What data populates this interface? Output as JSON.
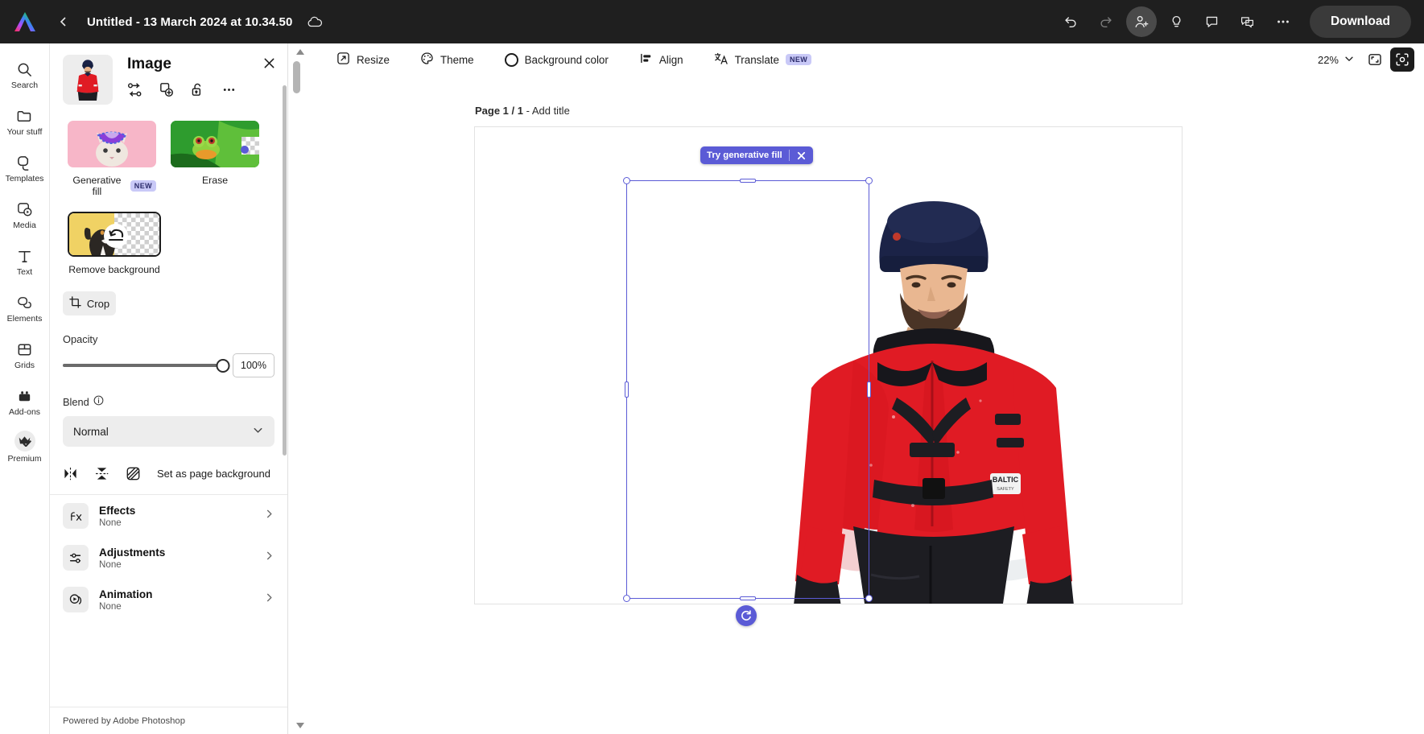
{
  "topbar": {
    "logo_icon": "adobe-express-logo",
    "back_icon": "chevron-left-icon",
    "title": "Untitled - 13 March 2024 at 10.34.50",
    "cloud_icon": "cloud-saved-icon",
    "undo_icon": "undo-icon",
    "redo_icon": "redo-icon",
    "invite_icon": "invite-collaborator-icon",
    "ideas_icon": "lightbulb-icon",
    "comment_icon": "comment-icon",
    "duplicate_comment_icon": "comments-stack-icon",
    "more_icon": "more-options-icon",
    "download_label": "Download"
  },
  "rail": {
    "items": [
      {
        "label": "Search",
        "icon": "search-icon"
      },
      {
        "label": "Your stuff",
        "icon": "folder-icon"
      },
      {
        "label": "Templates",
        "icon": "templates-icon"
      },
      {
        "label": "Media",
        "icon": "media-icon"
      },
      {
        "label": "Text",
        "icon": "text-icon"
      },
      {
        "label": "Elements",
        "icon": "elements-icon"
      },
      {
        "label": "Grids",
        "icon": "grids-icon"
      },
      {
        "label": "Add-ons",
        "icon": "addons-icon"
      },
      {
        "label": "Premium",
        "icon": "premium-crown-icon"
      }
    ]
  },
  "panel": {
    "title": "Image",
    "thumbnail_alt": "selected-image-thumbnail",
    "tools": [
      {
        "name": "replace-image-icon"
      },
      {
        "name": "duplicate-icon"
      },
      {
        "name": "unlock-icon"
      },
      {
        "name": "more-options-icon"
      }
    ],
    "close_icon": "close-icon",
    "ai_cards": [
      {
        "label": "Generative fill",
        "badge": "NEW",
        "thumb": "cat-with-bowtie-selection"
      },
      {
        "label": "Erase",
        "badge": "",
        "thumb": "green-frog-on-leaf"
      }
    ],
    "remove_background": {
      "label": "Remove background",
      "thumb": "dog-on-yellow-with-transparency",
      "overlay_icon": "undo-restore-icon",
      "selected": true
    },
    "crop": {
      "label": "Crop",
      "icon": "crop-icon"
    },
    "opacity": {
      "label": "Opacity",
      "value": "100%",
      "percent": 100
    },
    "blend": {
      "label": "Blend",
      "info_icon": "info-icon",
      "value": "Normal",
      "chevron": "chevron-down-icon"
    },
    "transform_row": {
      "flip_horizontal_icon": "flip-horizontal-icon",
      "flip_vertical_icon": "flip-vertical-icon",
      "page_background_icon": "set-as-page-background-icon",
      "page_background_label": "Set as page background"
    },
    "sections": [
      {
        "title": "Effects",
        "subtitle": "None",
        "icon": "fx-icon",
        "chevron": "chevron-right-icon"
      },
      {
        "title": "Adjustments",
        "subtitle": "None",
        "icon": "sliders-icon",
        "chevron": "chevron-right-icon"
      },
      {
        "title": "Animation",
        "subtitle": "None",
        "icon": "animation-icon",
        "chevron": "chevron-right-icon"
      }
    ],
    "footer": "Powered by Adobe Photoshop"
  },
  "canvas_toolbar": {
    "items": [
      {
        "label": "Resize",
        "icon": "resize-icon"
      },
      {
        "label": "Theme",
        "icon": "theme-palette-icon"
      },
      {
        "label": "Background color",
        "icon": "background-color-swatch"
      },
      {
        "label": "Align",
        "icon": "align-icon"
      },
      {
        "label": "Translate",
        "icon": "translate-icon",
        "badge": "NEW"
      }
    ],
    "zoom": {
      "value": "22%",
      "chevron": "chevron-down-icon"
    },
    "right_icons": [
      {
        "name": "fit-to-screen-icon",
        "active": false
      },
      {
        "name": "selection-tool-icon",
        "active": true
      }
    ]
  },
  "canvas": {
    "scroll_up_icon": "scroll-up-arrow-icon",
    "scroll_down_icon": "scroll-down-arrow-icon",
    "page_label_prefix": "Page 1 / 1",
    "page_label_sep": " - ",
    "page_label_action": "Add title",
    "generative_fill": {
      "label": "Try generative fill",
      "close_icon": "close-icon"
    },
    "rotate_icon": "rotate-handle-icon",
    "image_alt": "man-in-red-winter-jacket-and-navy-beanie"
  },
  "colors": {
    "topbar_bg": "#1f1f1f",
    "accent_purple": "#5b5bd6",
    "jacket_red": "#e01b24",
    "beanie_navy": "#1b2347",
    "badge_new_bg": "#c9c9f7",
    "panel_divider": "#e0e0e0"
  }
}
